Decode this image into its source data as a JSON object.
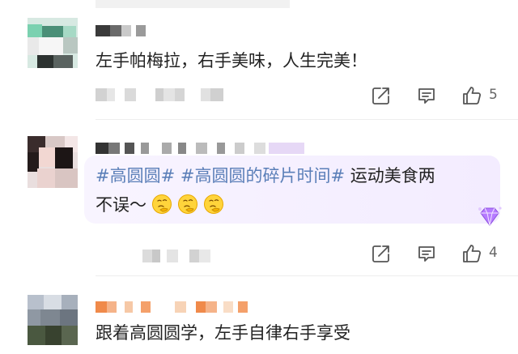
{
  "comments": [
    {
      "text": "左手帕梅拉，右手美味，人生完美！",
      "likes": "5"
    },
    {
      "hashtag1": "#高圆圆#",
      "hashtag2": "#高圆圆的碎片时间#",
      "text_line1_rest": "运动美食两",
      "text_line2": "不误～",
      "likes": "4"
    },
    {
      "text": "跟着高圆圆学，左手自律右手享受"
    }
  ],
  "icons": {
    "share": "share-icon",
    "comment": "comment-icon",
    "like": "like-icon",
    "badge": "diamond-badge-icon",
    "emoji": "thinking-emoji"
  },
  "colors": {
    "hashtag": "#5b7fb8",
    "bubble": "#f5efff",
    "text": "#222222",
    "icon": "#555555"
  }
}
